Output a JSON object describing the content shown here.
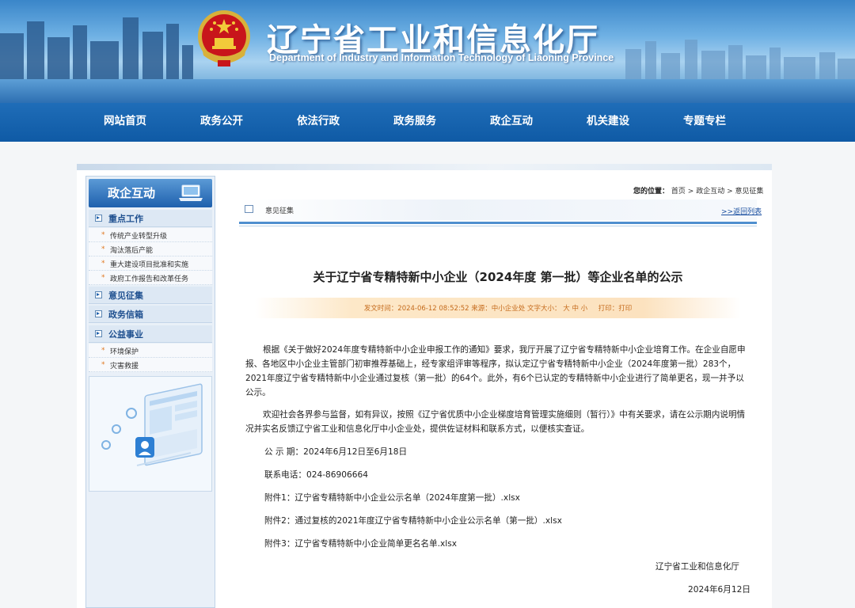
{
  "header": {
    "title_cn": "辽宁省工业和信息化厅",
    "title_en": "Department of Industry and Information Technology of Liaoning Province"
  },
  "nav": [
    "网站首页",
    "政务公开",
    "依法行政",
    "政务服务",
    "政企互动",
    "机关建设",
    "专题专栏"
  ],
  "sidebar": {
    "title": "政企互动",
    "groups": [
      {
        "label": "重点工作"
      },
      {
        "label": "意见征集"
      },
      {
        "label": "政务信箱"
      },
      {
        "label": "公益事业"
      }
    ],
    "key_work_items": [
      "传统产业转型升级",
      "淘汰落后产能",
      "重大建设项目批准和实施",
      "政府工作报告和改革任务"
    ],
    "public_items": [
      "环境保护",
      "灾害救援"
    ]
  },
  "location": {
    "label": "您的位置：",
    "crumbs": [
      "首页",
      "政企互动",
      "意见征集"
    ],
    "sep": ">"
  },
  "section": {
    "label": "意见征集",
    "back": ">>返回列表"
  },
  "article": {
    "title": "关于辽宁省专精特新中小企业（2024年度  第一批）等企业名单的公示",
    "meta": {
      "time": "发文时间：2024-06-12 08:52:52",
      "source": "来源：中小企业处",
      "font_size": "文字大小：",
      "sizes": [
        "大",
        "中",
        "小"
      ],
      "print": "打印：打印"
    },
    "para1": "根据《关于做好2024年度专精特新中小企业申报工作的通知》要求，我厅开展了辽宁省专精特新中小企业培育工作。在企业自愿申报、各地区中小企业主管部门初审推荐基础上，经专家组评审等程序，拟认定辽宁省专精特新中小企业（2024年度第一批）283个，2021年度辽宁省专精特新中小企业通过复核（第一批）的64个。此外，有6个已认定的专精特新中小企业进行了简单更名，现一并予以公示。",
    "para2": "欢迎社会各界参与监督，如有异议，按照《辽宁省优质中小企业梯度培育管理实施细则（暂行）》中有关要求，请在公示期内说明情况并实名反馈辽宁省工业和信息化厅中小企业处，提供佐证材料和联系方式，以便核实查证。",
    "period": "公 示 期：2024年6月12日至6月18日",
    "phone": "联系电话：024-86906664",
    "attachments": [
      {
        "prefix": "附件1：",
        "name": "辽宁省专精特新中小企业公示名单（2024年度第一批）.xlsx"
      },
      {
        "prefix": "附件2：",
        "name": "通过复核的2021年度辽宁省专精特新中小企业公示名单（第一批）.xlsx"
      },
      {
        "prefix": "附件3：",
        "name": "辽宁省专精特新中小企业简单更名名单.xlsx"
      }
    ],
    "signature": "辽宁省工业和信息化厅",
    "date": "2024年6月12日"
  },
  "colors": {
    "nav_bg": "#1266b5",
    "accent_orange": "#c56b1c",
    "link": "#1a4fa0"
  }
}
